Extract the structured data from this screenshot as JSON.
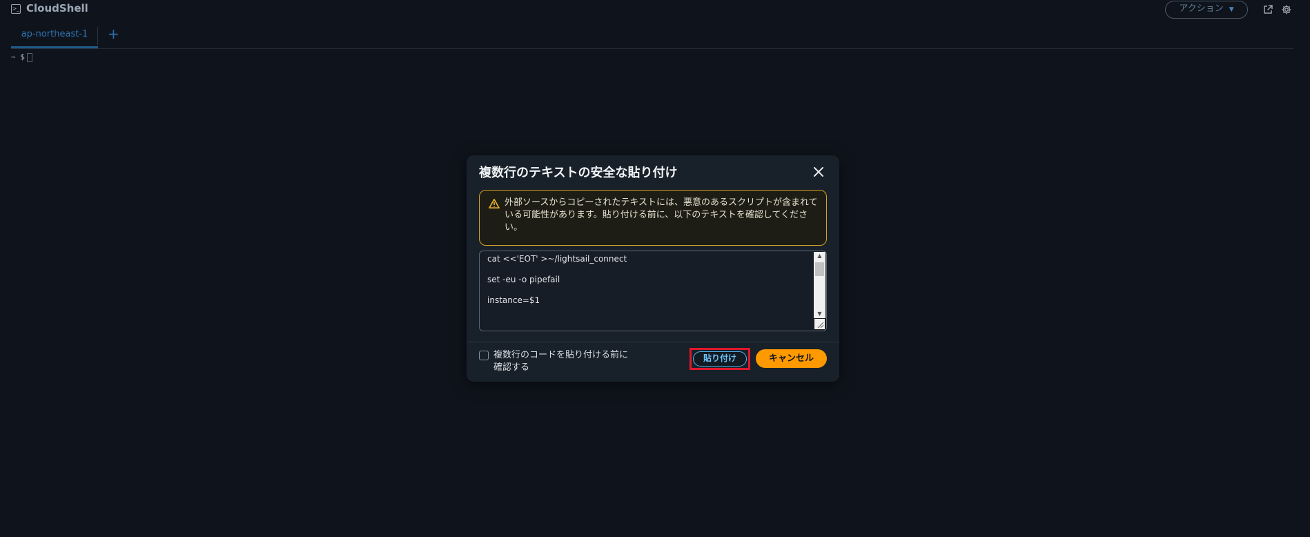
{
  "header": {
    "app_title": "CloudShell",
    "actions_label": "アクション",
    "icons": [
      "terminal-icon",
      "chevron-down-icon",
      "external-link-icon",
      "settings-gear-icon"
    ]
  },
  "tabs": {
    "active_tab": "ap-northeast-1",
    "add_tab_label": "+"
  },
  "terminal": {
    "prompt": "~ $"
  },
  "modal": {
    "title": "複数行のテキストの安全な貼り付け",
    "warning_text": "外部ソースからコピーされたテキストには、悪意のあるスクリプトが含まれている可能性があります。貼り付ける前に、以下のテキストを確認してください。",
    "code_lines": [
      "cat <<'EOT' >~/lightsail_connect",
      "",
      "set -eu -o pipefail",
      "",
      "instance=$1"
    ],
    "checkbox_label": "複数行のコードを貼り付ける前に確認する",
    "checkbox_checked": false,
    "paste_label": "貼り付け",
    "cancel_label": "キャンセル"
  },
  "colors": {
    "background": "#0f141c",
    "modal_background": "#182029",
    "accent_orange": "#ff9900",
    "warning_border": "#d7a428",
    "tab_blue": "#2e72b0",
    "highlight_red": "#e0182b"
  }
}
